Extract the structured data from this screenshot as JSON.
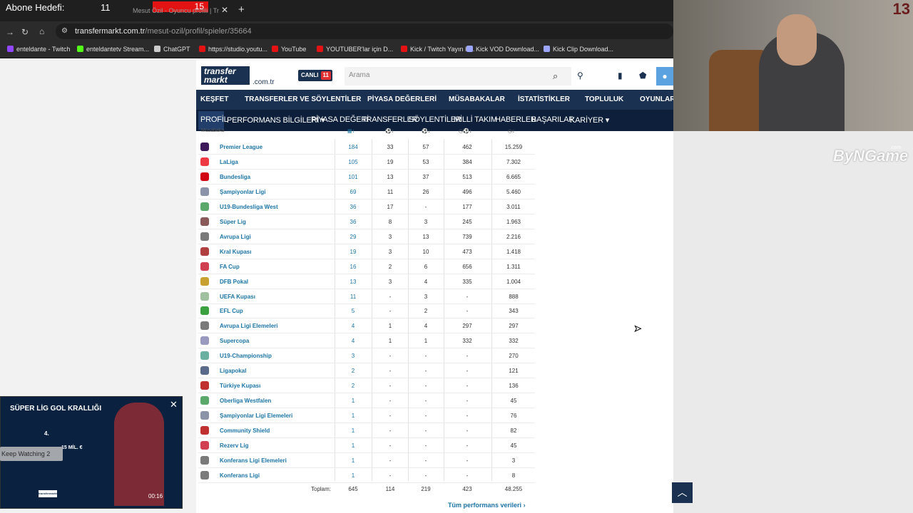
{
  "stream": {
    "abone_label": "Abone Hedefi:",
    "abone_count": "11",
    "abone_target": "15",
    "abone_progress_fraction": 0.73
  },
  "browser": {
    "tab_title": "Mesut Özil - Oyuncu profili | Tr",
    "url_host": "transfermarkt.com.tr",
    "url_path": "/mesut-ozil/profil/spieler/35664",
    "bookmarks": [
      {
        "label": "enteldante - Twitch",
        "color": "#9146ff"
      },
      {
        "label": "enteldantetv Stream...",
        "color": "#53fc18"
      },
      {
        "label": "ChatGPT",
        "color": "#cccccc"
      },
      {
        "label": "https://studio.youtu...",
        "color": "#e41313"
      },
      {
        "label": "YouTube",
        "color": "#e41313"
      },
      {
        "label": "YOUTUBER'lar için D...",
        "color": "#e41313"
      },
      {
        "label": "Kick / Twitch Yayın K...",
        "color": "#e41313"
      },
      {
        "label": "Kick VOD Download...",
        "color": "#9da6ff"
      },
      {
        "label": "Kick Clip Download...",
        "color": "#9da6ff"
      }
    ]
  },
  "tm": {
    "logo_line1": "transfer",
    "logo_line2": "markt",
    "logo_sub": ".com.tr",
    "canli_label": "CANLI",
    "canli_count": "11",
    "search_placeholder": "Arama",
    "main_nav": [
      "KEŞFET",
      "TRANSFERLER VE SÖYLENTİLER",
      "PİYASA DEĞERLERİ",
      "MÜSABAKALAR",
      "İSTATİSTİKLER",
      "TOPLULUK",
      "OYUNLAR"
    ],
    "sub_nav": [
      "PROFİL",
      "PERFORMANS BİLGİLERİ ▾",
      "PİYASA DEĞERİ",
      "TRANSFERLER",
      "SÖYLENTİLER",
      "MİLLİ TAKIM",
      "HABERLER",
      "BAŞARILAR",
      "KARİYER ▾"
    ],
    "table_header": "Müsabaka",
    "rows": [
      {
        "name": "Premier League",
        "apps": "184",
        "goals": "33",
        "assists": "57",
        "mpg": "462",
        "minutes": "15.259",
        "color": "#3d195b"
      },
      {
        "name": "LaLiga",
        "apps": "105",
        "goals": "19",
        "assists": "53",
        "mpg": "384",
        "minutes": "7.302",
        "color": "#ee3a43"
      },
      {
        "name": "Bundesliga",
        "apps": "101",
        "goals": "13",
        "assists": "37",
        "mpg": "513",
        "minutes": "6.665",
        "color": "#d20515"
      },
      {
        "name": "Şampiyonlar Ligi",
        "apps": "69",
        "goals": "11",
        "assists": "26",
        "mpg": "496",
        "minutes": "5.460",
        "color": "#8b93a8"
      },
      {
        "name": "U19-Bundesliga West",
        "apps": "36",
        "goals": "17",
        "assists": "-",
        "mpg": "177",
        "minutes": "3.011",
        "color": "#5aa86a"
      },
      {
        "name": "Süper Lig",
        "apps": "36",
        "goals": "8",
        "assists": "3",
        "mpg": "245",
        "minutes": "1.963",
        "color": "#8a5a5a"
      },
      {
        "name": "Avrupa Ligi",
        "apps": "29",
        "goals": "3",
        "assists": "13",
        "mpg": "739",
        "minutes": "2.216",
        "color": "#7a7a7a"
      },
      {
        "name": "Kral Kupası",
        "apps": "19",
        "goals": "3",
        "assists": "10",
        "mpg": "473",
        "minutes": "1.418",
        "color": "#b04040"
      },
      {
        "name": "FA Cup",
        "apps": "16",
        "goals": "2",
        "assists": "6",
        "mpg": "656",
        "minutes": "1.311",
        "color": "#d04050"
      },
      {
        "name": "DFB Pokal",
        "apps": "13",
        "goals": "3",
        "assists": "4",
        "mpg": "335",
        "minutes": "1.004",
        "color": "#c8a030"
      },
      {
        "name": "UEFA Kupası",
        "apps": "11",
        "goals": "-",
        "assists": "3",
        "mpg": "-",
        "minutes": "888",
        "color": "#a0c0a0"
      },
      {
        "name": "EFL Cup",
        "apps": "5",
        "goals": "-",
        "assists": "2",
        "mpg": "-",
        "minutes": "343",
        "color": "#3aa040"
      },
      {
        "name": "Avrupa Ligi Elemeleri",
        "apps": "4",
        "goals": "1",
        "assists": "4",
        "mpg": "297",
        "minutes": "297",
        "color": "#7a7a7a"
      },
      {
        "name": "Supercopa",
        "apps": "4",
        "goals": "1",
        "assists": "1",
        "mpg": "332",
        "minutes": "332",
        "color": "#9a9ac0"
      },
      {
        "name": "U19-Championship",
        "apps": "3",
        "goals": "-",
        "assists": "-",
        "mpg": "-",
        "minutes": "270",
        "color": "#6ab0a0"
      },
      {
        "name": "Ligapokal",
        "apps": "2",
        "goals": "-",
        "assists": "-",
        "mpg": "-",
        "minutes": "121",
        "color": "#5a6a8a"
      },
      {
        "name": "Türkiye Kupası",
        "apps": "2",
        "goals": "-",
        "assists": "-",
        "mpg": "-",
        "minutes": "136",
        "color": "#c03030"
      },
      {
        "name": "Oberliga Westfalen",
        "apps": "1",
        "goals": "-",
        "assists": "-",
        "mpg": "-",
        "minutes": "45",
        "color": "#5aa86a"
      },
      {
        "name": "Şampiyonlar Ligi Elemeleri",
        "apps": "1",
        "goals": "-",
        "assists": "-",
        "mpg": "-",
        "minutes": "76",
        "color": "#8b93a8"
      },
      {
        "name": "Community Shield",
        "apps": "1",
        "goals": "-",
        "assists": "-",
        "mpg": "-",
        "minutes": "82",
        "color": "#c03030"
      },
      {
        "name": "Rezerv Lig",
        "apps": "1",
        "goals": "-",
        "assists": "-",
        "mpg": "-",
        "minutes": "45",
        "color": "#d04050"
      },
      {
        "name": "Konferans Ligi Elemeleri",
        "apps": "1",
        "goals": "-",
        "assists": "-",
        "mpg": "-",
        "minutes": "3",
        "color": "#7a7a7a"
      },
      {
        "name": "Konferans Ligi",
        "apps": "1",
        "goals": "-",
        "assists": "-",
        "mpg": "-",
        "minutes": "8",
        "color": "#7a7a7a"
      }
    ],
    "totals": {
      "label": "Toplam:",
      "apps": "645",
      "goals": "114",
      "assists": "219",
      "mpg": "423",
      "minutes": "48.255"
    },
    "all_performance_link": "Tüm performans verileri"
  },
  "overlay": {
    "brand": "ByNGame",
    "brand_sub": ".com",
    "cam_number": "13"
  },
  "video": {
    "title": "SÜPER LİG GOL KRALLIĞI",
    "rank": "4.",
    "fee": "15 MİL. €",
    "keep_watching": "Keep Watching 2",
    "time": "00:16",
    "logo": "transfermarkt"
  }
}
